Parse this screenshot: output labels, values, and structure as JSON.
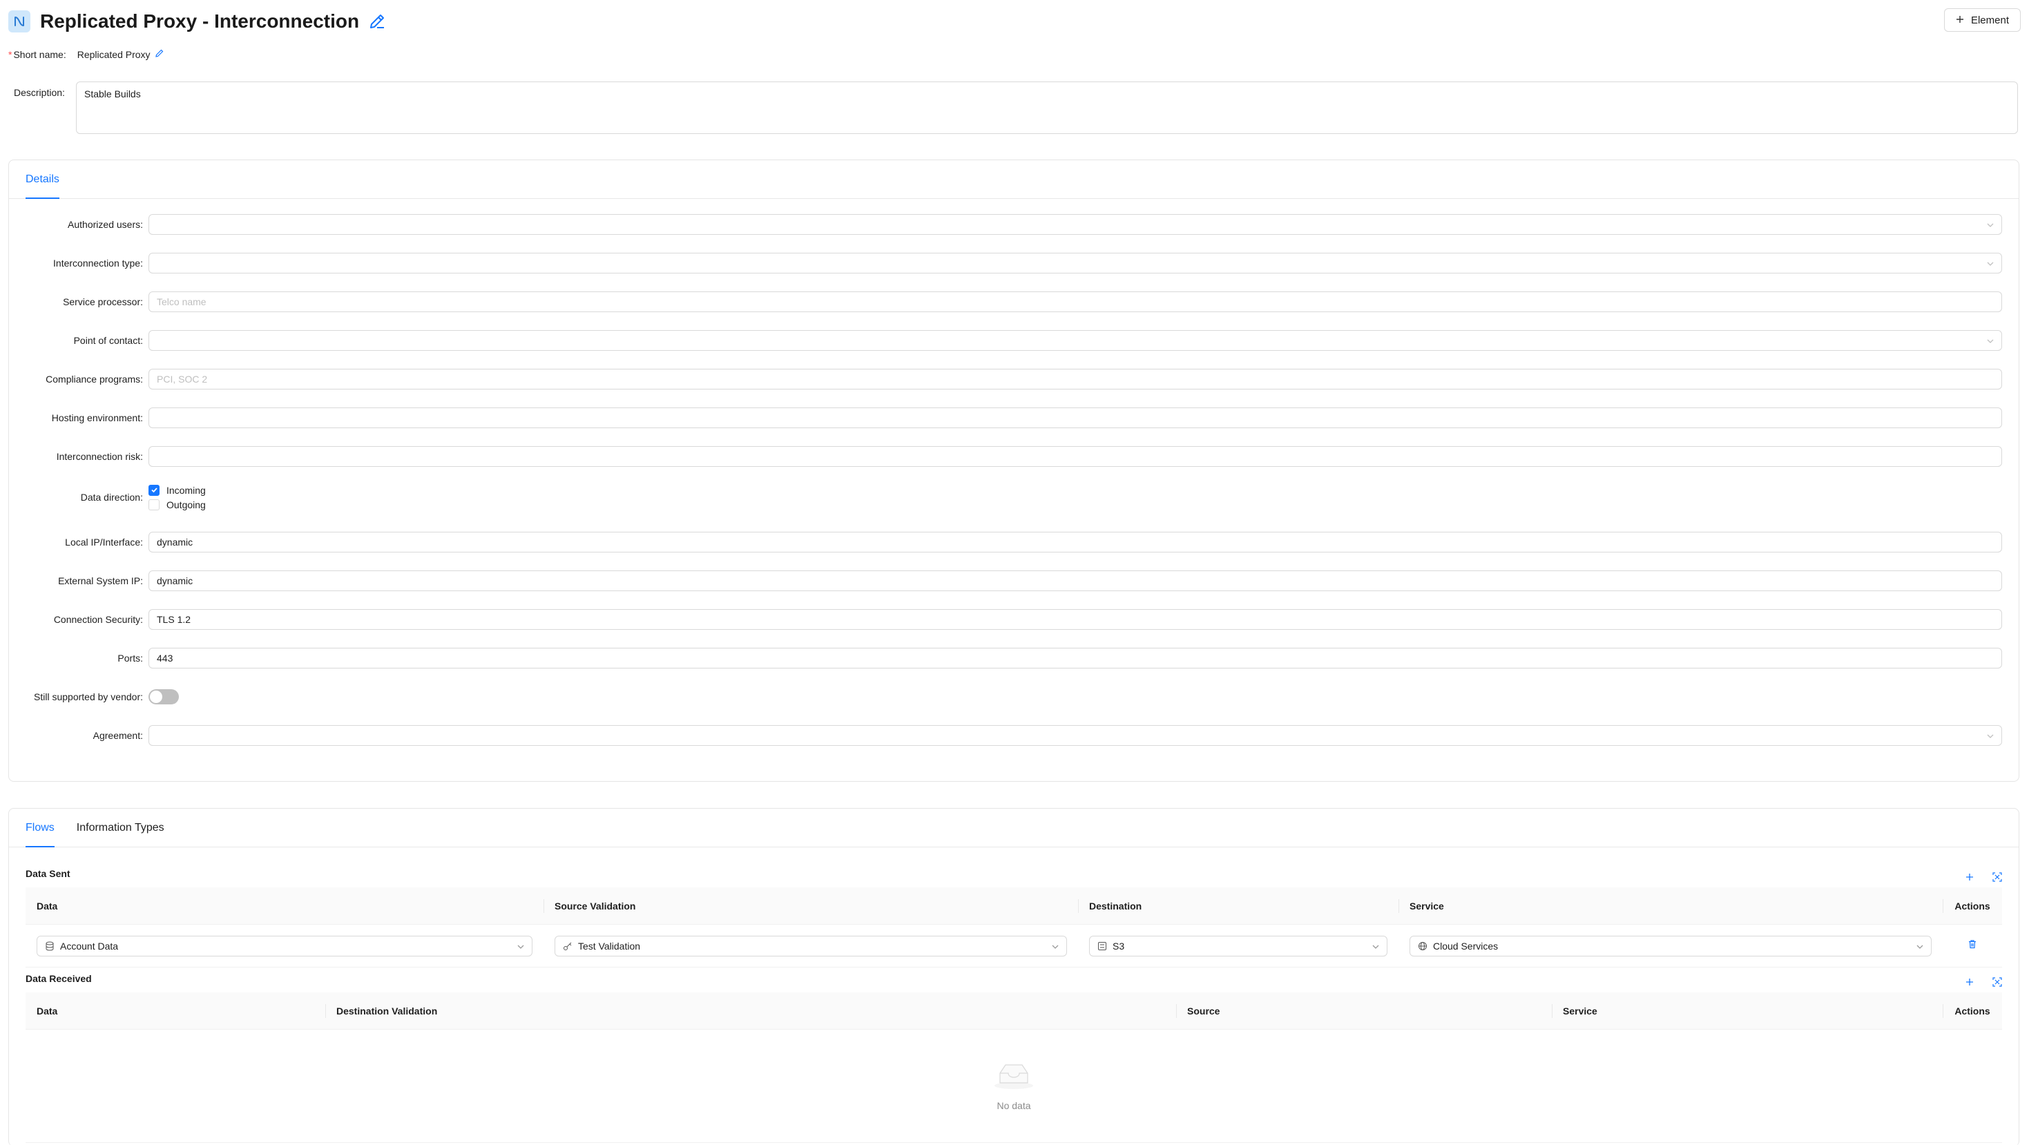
{
  "header": {
    "title": "Replicated Proxy - Interconnection",
    "element_button": "Element"
  },
  "short_name": {
    "label": "Short name",
    "value": "Replicated Proxy"
  },
  "description": {
    "label": "Description",
    "value": "Stable Builds"
  },
  "details": {
    "tab": "Details",
    "fields": {
      "authorized_users": {
        "label": "Authorized users",
        "value": ""
      },
      "interconnection_type": {
        "label": "Interconnection type",
        "value": ""
      },
      "service_processor": {
        "label": "Service processor",
        "placeholder": "Telco name"
      },
      "point_of_contact": {
        "label": "Point of contact",
        "value": ""
      },
      "compliance_programs": {
        "label": "Compliance programs",
        "placeholder": "PCI, SOC 2"
      },
      "hosting_environment": {
        "label": "Hosting environment",
        "value": ""
      },
      "interconnection_risk": {
        "label": "Interconnection risk",
        "value": ""
      },
      "data_direction": {
        "label": "Data direction",
        "incoming": "Incoming",
        "outgoing": "Outgoing"
      },
      "local_ip": {
        "label": "Local IP/Interface",
        "value": "dynamic"
      },
      "external_ip": {
        "label": "External System IP",
        "value": "dynamic"
      },
      "connection_security": {
        "label": "Connection Security",
        "value": "TLS 1.2"
      },
      "ports": {
        "label": "Ports",
        "value": "443"
      },
      "vendor_supported": {
        "label": "Still supported by vendor"
      },
      "agreement": {
        "label": "Agreement",
        "value": ""
      }
    }
  },
  "flows": {
    "tabs": [
      "Flows",
      "Information Types"
    ],
    "data_sent": {
      "title": "Data Sent",
      "columns": [
        "Data",
        "Source Validation",
        "Destination",
        "Service",
        "Actions"
      ],
      "rows": [
        {
          "data": "Account Data",
          "source_validation": "Test Validation",
          "destination": "S3",
          "service": "Cloud Services"
        }
      ]
    },
    "data_received": {
      "title": "Data Received",
      "columns": [
        "Data",
        "Destination Validation",
        "Source",
        "Service",
        "Actions"
      ],
      "empty_text": "No data"
    }
  }
}
